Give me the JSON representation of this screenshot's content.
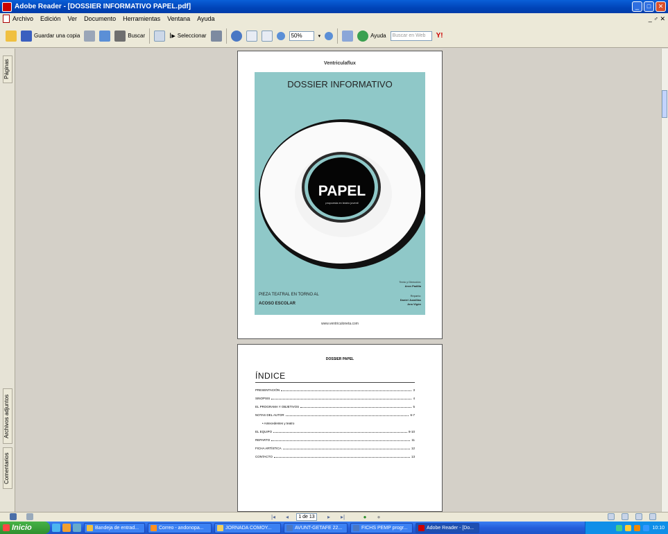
{
  "window": {
    "title": "Adobe Reader - [DOSSIER INFORMATIVO PAPEL.pdf]"
  },
  "menu": {
    "items": [
      "Archivo",
      "Edición",
      "Ver",
      "Documento",
      "Herramientas",
      "Ventana",
      "Ayuda"
    ],
    "right": "_ ♂ ✕"
  },
  "toolbar": {
    "save_copy": "Guardar una copia",
    "search": "Buscar",
    "select": "Seleccionar",
    "zoom": "50%",
    "help": "Ayuda",
    "search_web_placeholder": "Buscar en Web"
  },
  "sidepanel": {
    "pages_tab": "Páginas",
    "attachments_tab": "Archivos adjuntos",
    "comments_tab": "Comentarios"
  },
  "page1": {
    "header": "Ventriculaflux",
    "title": "DOSSIER INFORMATIVO",
    "papel": "PAPEL",
    "papel_sub": "propuesta en teatro juvenil",
    "credit1_label": "Texto y Dirección:",
    "credit1_name": "Aron Padilla",
    "line1": "PIEZA TEATRAL EN TORNO AL",
    "line2": "ACOSO ESCOLAR",
    "credit2_label": "Reparto:",
    "credit2_name1": "Daniel Juanillas",
    "credit2_name2": "Ana Vigón",
    "url": "www.ventriculoneta.com"
  },
  "page2": {
    "header": "DOSSIER PAPEL",
    "index_title": "ÍNDICE",
    "toc": [
      {
        "label": "PRESENTACIÓN",
        "page": "3"
      },
      {
        "label": "SINOPSIS",
        "page": "4"
      },
      {
        "label": "EL PROGRAMA Y OBJETIVOS",
        "page": "5"
      },
      {
        "label": "NOTAS DEL AUTOR",
        "page": "6-7"
      },
      {
        "label": "• Antecedentes y teatro",
        "page": ""
      },
      {
        "label": "EL EQUIPO",
        "page": "8-10"
      },
      {
        "label": "REPARTO",
        "page": "11"
      },
      {
        "label": "FICHA ARTÍSTICA",
        "page": "12"
      },
      {
        "label": "CONTACTO",
        "page": "13"
      }
    ]
  },
  "nav": {
    "page_indicator": "1 de 13"
  },
  "taskbar": {
    "start": "Inicio",
    "tasks": [
      "Bandeja de entrad...",
      "Correo - andonopa...",
      "JORNADA COMOY...",
      "AVUNT-GETAFE 22...",
      "FICHS PEMP progr...",
      "Adobe Reader - [Do..."
    ],
    "clock": "10:10"
  },
  "colors": {
    "cover_bg": "#8fc8c8",
    "title_bar": "#0a5fd8"
  }
}
